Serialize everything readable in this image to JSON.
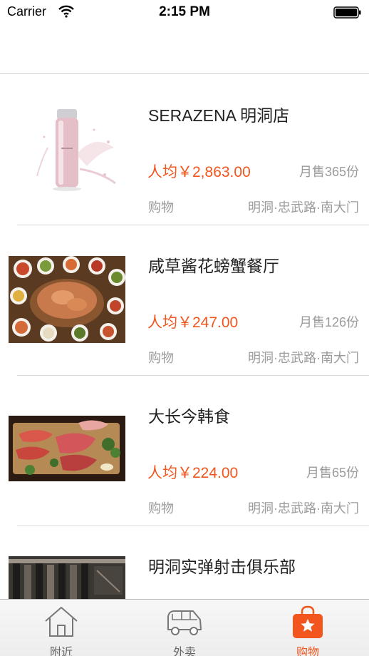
{
  "status_bar": {
    "carrier": "Carrier",
    "time": "2:15 PM"
  },
  "listings": [
    {
      "name": "SERAZENA 明洞店",
      "price": "人均￥2,863.00",
      "sales": "月售365份",
      "category": "购物",
      "location": "明洞·忠武路·南大门",
      "image": "perfume-bottle"
    },
    {
      "name": "咸草酱花螃蟹餐厅",
      "price": "人均￥247.00",
      "sales": "月售126份",
      "category": "购物",
      "location": "明洞·忠武路·南大门",
      "image": "crab-feast"
    },
    {
      "name": "大长今韩食",
      "price": "人均￥224.00",
      "sales": "月售65份",
      "category": "购物",
      "location": "明洞·忠武路·南大门",
      "image": "raw-beef-platter"
    },
    {
      "name": "明洞实弹射击俱乐部",
      "image": "gun-rack"
    }
  ],
  "tabs": [
    {
      "label": "附近",
      "icon": "house-icon",
      "active": false
    },
    {
      "label": "外卖",
      "icon": "van-icon",
      "active": false
    },
    {
      "label": "购物",
      "icon": "shopping-bag-star-icon",
      "active": true
    }
  ],
  "colors": {
    "accent": "#f2561e",
    "muted": "#9b9b9b"
  }
}
